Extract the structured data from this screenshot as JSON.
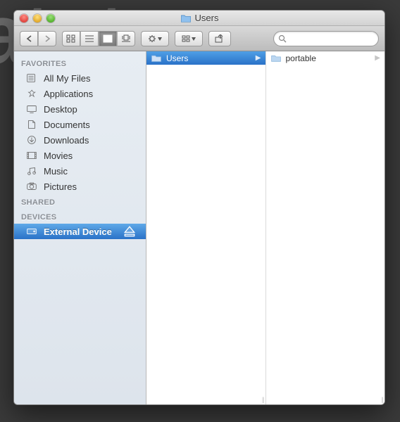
{
  "window": {
    "title": "Users"
  },
  "sidebar": {
    "headings": {
      "favorites": "FAVORITES",
      "shared": "SHARED",
      "devices": "DEVICES"
    },
    "favorites": [
      {
        "icon": "all-my-files-icon",
        "label": "All My Files"
      },
      {
        "icon": "applications-icon",
        "label": "Applications"
      },
      {
        "icon": "desktop-icon",
        "label": "Desktop"
      },
      {
        "icon": "documents-icon",
        "label": "Documents"
      },
      {
        "icon": "downloads-icon",
        "label": "Downloads"
      },
      {
        "icon": "movies-icon",
        "label": "Movies"
      },
      {
        "icon": "music-icon",
        "label": "Music"
      },
      {
        "icon": "pictures-icon",
        "label": "Pictures"
      }
    ],
    "devices": [
      {
        "icon": "external-drive-icon",
        "label": "External Device",
        "selected": true,
        "ejectable": true
      }
    ]
  },
  "columns": [
    {
      "items": [
        {
          "label": "Users",
          "selected": true,
          "is_folder": true,
          "has_children": true
        }
      ]
    },
    {
      "items": [
        {
          "label": "portable",
          "selected": false,
          "is_folder": true,
          "has_children": true
        }
      ]
    }
  ],
  "search": {
    "placeholder": ""
  }
}
